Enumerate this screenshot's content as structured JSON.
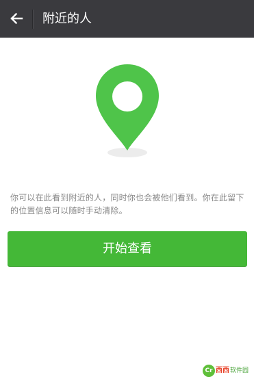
{
  "header": {
    "title": "附近的人"
  },
  "main": {
    "hint_text": "你可以在此看到附近的人，同时你也会被他们看到。你在此留下的位置信息可以随时手动清除。",
    "start_button_label": "开始查看"
  },
  "watermark": {
    "logo_text": "Cr",
    "brand_text": "西西",
    "brand_sub": "软件园"
  },
  "colors": {
    "topbar": "#3a3a3e",
    "accent_green": "#44b837",
    "pin_green": "#4fc44a"
  },
  "icons": {
    "back": "arrow-left-icon",
    "pin": "location-pin-icon"
  }
}
